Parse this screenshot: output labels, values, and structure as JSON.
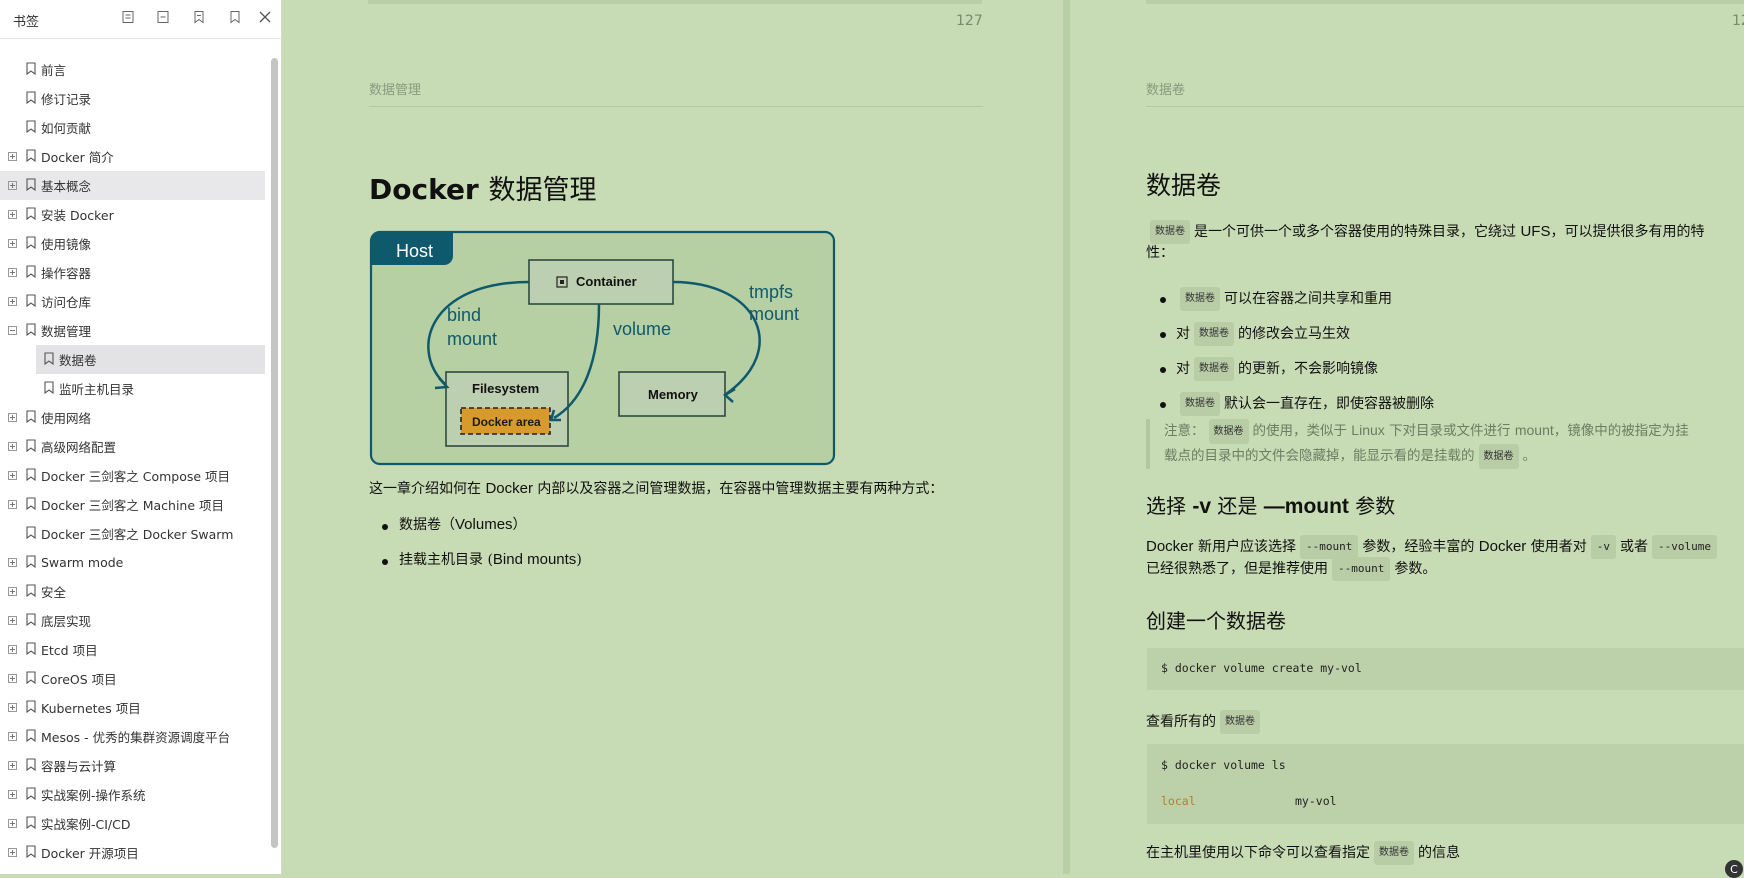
{
  "sidebar": {
    "title": "书签",
    "tools": [
      "expand-all-icon",
      "collapse-all-icon",
      "add-bookmark-icon",
      "bookmark-icon",
      "close-icon"
    ],
    "items": [
      {
        "label": "前言",
        "expander": false,
        "level": 0
      },
      {
        "label": "修订记录",
        "expander": false,
        "level": 0
      },
      {
        "label": "如何贡献",
        "expander": false,
        "level": 0
      },
      {
        "label": "Docker 简介",
        "expander": true,
        "level": 0
      },
      {
        "label": "基本概念",
        "expander": true,
        "level": 0,
        "state": "hover"
      },
      {
        "label": "安装 Docker",
        "expander": true,
        "level": 0
      },
      {
        "label": "使用镜像",
        "expander": true,
        "level": 0
      },
      {
        "label": "操作容器",
        "expander": true,
        "level": 0
      },
      {
        "label": "访问仓库",
        "expander": true,
        "level": 0
      },
      {
        "label": "数据管理",
        "expander": true,
        "expanded": true,
        "level": 0
      },
      {
        "label": "数据卷",
        "expander": false,
        "level": 1,
        "state": "selected"
      },
      {
        "label": "监听主机目录",
        "expander": false,
        "level": 1
      },
      {
        "label": "使用网络",
        "expander": true,
        "level": 0
      },
      {
        "label": "高级网络配置",
        "expander": true,
        "level": 0
      },
      {
        "label": "Docker 三剑客之 Compose 项目",
        "expander": true,
        "level": 0
      },
      {
        "label": "Docker 三剑客之 Machine 项目",
        "expander": true,
        "level": 0
      },
      {
        "label": "Docker 三剑客之 Docker Swarm",
        "expander": false,
        "level": 0
      },
      {
        "label": "Swarm mode",
        "expander": true,
        "level": 0
      },
      {
        "label": "安全",
        "expander": true,
        "level": 0
      },
      {
        "label": "底层实现",
        "expander": true,
        "level": 0
      },
      {
        "label": "Etcd 项目",
        "expander": true,
        "level": 0
      },
      {
        "label": "CoreOS 项目",
        "expander": true,
        "level": 0
      },
      {
        "label": "Kubernetes 项目",
        "expander": true,
        "level": 0
      },
      {
        "label": "Mesos - 优秀的集群资源调度平台",
        "expander": true,
        "level": 0
      },
      {
        "label": "容器与云计算",
        "expander": true,
        "level": 0
      },
      {
        "label": "实战案例-操作系统",
        "expander": true,
        "level": 0
      },
      {
        "label": "实战案例-CI/CD",
        "expander": true,
        "level": 0
      },
      {
        "label": "Docker 开源项目",
        "expander": true,
        "level": 0
      }
    ]
  },
  "left_page": {
    "page_number": "127",
    "running_header": "数据管理",
    "heading_en": "Docker",
    "heading_cn": "数据管理",
    "diagram": {
      "host": "Host",
      "container": "Container",
      "bind_mount_1": "bind",
      "bind_mount_2": "mount",
      "volume": "volume",
      "tmpfs_1": "tmpfs",
      "tmpfs_2": "mount",
      "filesystem": "Filesystem",
      "docker_area": "Docker area",
      "memory": "Memory"
    },
    "intro_a": "这一章介绍如何在",
    "intro_b": "Docker",
    "intro_c": "内部以及容器之间管理数据，在容器中管理数据主要有两种方式：",
    "bullets": [
      {
        "cn": "数据卷（",
        "en": "Volumes",
        "end": "）"
      },
      {
        "cn": "挂载主机目录 (",
        "en": "Bind mounts",
        "end": ")"
      }
    ]
  },
  "right_page": {
    "page_number": "12",
    "running_header": "数据卷",
    "heading": "数据卷",
    "chip": "数据卷",
    "para1_a": "是一个可供一个或多个容器使用的特殊目录，它绕过",
    "para1_b": "UFS",
    "para1_c": "，可以提供很多有用的特",
    "para1_d": "性：",
    "bullets": [
      {
        "pre": "",
        "post": "可以在容器之间共享和重用",
        "chip_first": true
      },
      {
        "pre": "对",
        "post": "的修改会立马生效",
        "chip_first": false
      },
      {
        "pre": "对",
        "post": "的更新，不会影响镜像",
        "chip_first": false
      },
      {
        "pre": "",
        "post": "默认会一直存在，即使容器被删除",
        "chip_first": true
      }
    ],
    "note_a": "注意：",
    "note_b": "的使用，类似于",
    "note_c": "Linux",
    "note_d": "下对目录或文件进行",
    "note_e": "mount",
    "note_f": "，镜像中的被指定为挂",
    "note_g": "载点的目录中的文件会隐藏掉，能显示看的是挂载的",
    "note_h": "。",
    "h2_a": "选择",
    "h2_b": "-v",
    "h2_c": "还是",
    "h2_d": "—mount",
    "h2_e": "参数",
    "para2_a": "Docker",
    "para2_b": "新用户应该选择",
    "para2_code1": "--mount",
    "para2_c": "参数，经验丰富的",
    "para2_d": "Docker",
    "para2_e": "使用者对",
    "para2_code2": "-v",
    "para2_f": "或者",
    "para2_code3": "--volume",
    "para2_g": "已经很熟悉了，但是推荐使用",
    "para2_code4": "--mount",
    "para2_h": "参数。",
    "h2_create": "创建一个数据卷",
    "cmd_create": "$ docker volume create my-vol",
    "list_text": "查看所有的",
    "cmd_ls": "$ docker volume ls",
    "ls_driver": "local",
    "ls_name": "my-vol",
    "inspect_a": "在主机里使用以下命令可以查看指定",
    "inspect_b": "的信息"
  },
  "floating_badge": "C",
  "colors": {
    "page_bg": "#c7dbb4",
    "diagram_teal": "#0e5a6c",
    "diagram_accent": "#d79a2b",
    "code_keyword": "#c0782a"
  }
}
